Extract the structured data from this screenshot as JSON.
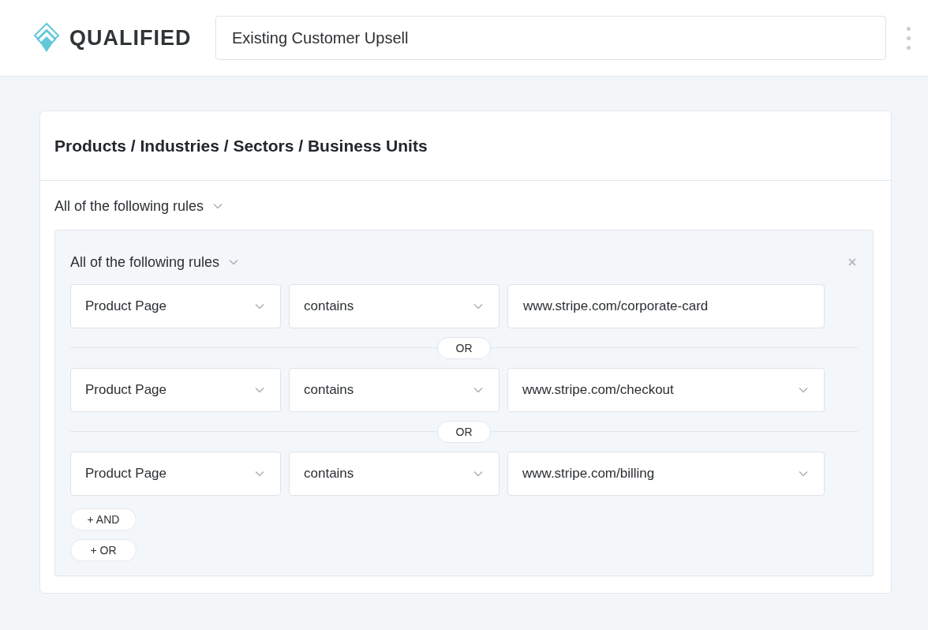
{
  "header": {
    "brand": "QUALIFIED",
    "title_value": "Existing Customer Upsell"
  },
  "section": {
    "title": "Products / Industries / Sectors / Business Units",
    "outer_match": "All of the following rules",
    "group": {
      "match": "All of the following rules",
      "rows": [
        {
          "field": "Product Page",
          "operator": "contains",
          "value": "www.stripe.com/corporate-card",
          "kind": "input"
        },
        {
          "separator": "OR",
          "field": "Product Page",
          "operator": "contains",
          "value": "www.stripe.com/checkout",
          "kind": "select"
        },
        {
          "separator": "OR",
          "field": "Product Page",
          "operator": "contains",
          "value": "www.stripe.com/billing",
          "kind": "select"
        }
      ],
      "buttons": [
        "+ AND",
        "+ OR"
      ]
    }
  }
}
